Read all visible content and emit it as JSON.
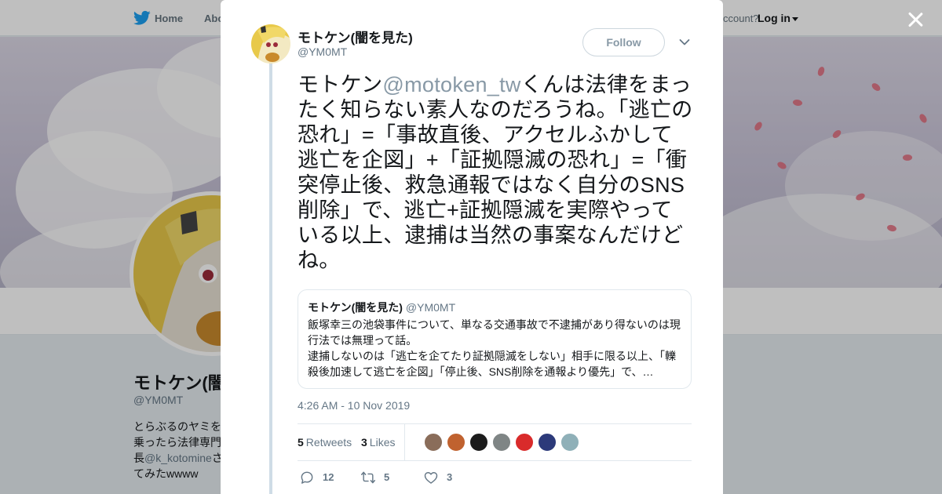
{
  "background_page": {
    "nav": {
      "home_label": "Home",
      "about_label": "Abo",
      "account_question": "ccount?",
      "login_label": "Log in"
    },
    "profile": {
      "name": "モトケン(闇",
      "handle": "@YM0MT",
      "bio_lines": [
        "とらぶるのヤミを",
        "乗ったら法律専門"
      ],
      "bio_line3_prefix": "長",
      "bio_mention": "@k_kotomine",
      "bio_line3_suffix": "さ",
      "bio_line4": "てみたwwww"
    }
  },
  "modal": {
    "close_label": "Close",
    "author": {
      "name": "モトケン(闇を見た)",
      "handle": "@YM0MT"
    },
    "follow_label": "Follow",
    "tweet": {
      "text_prefix": "モトケン",
      "mention": "@motoken_tw",
      "text_body": "くんは法律をまったく知らない素人なのだろうね。「逃亡の恐れ」=「事故直後、アクセルふかして逃亡を企図」+「証拠隠滅の恐れ」=「衝突停止後、救急通報ではなく自分のSNS削除」で、逃亡+証拠隠滅を実際やっている以上、逮捕は当然の事案なんだけどね。"
    },
    "quoted_tweet": {
      "name": "モトケン(闇を見た)",
      "handle": "@YM0MT",
      "text": "飯塚幸三の池袋事件について、単なる交通事故で不逮捕があり得ないのは現行法では無理って話。\n逮捕しないのは「逃亡を企てたり証拠隠滅をしない」相手に限る以上、「轢殺後加速して逃亡を企図」「停止後、SNS削除を通報より優先」で、…"
    },
    "timestamp": "4:26 AM - 10 Nov 2019",
    "stats": {
      "retweets_count": "5",
      "retweets_label": "Retweets",
      "likes_count": "3",
      "likes_label": "Likes"
    },
    "liker_avatar_colors": [
      "#8a6d5a",
      "#c0622f",
      "#1c1c1c",
      "#7f8585",
      "#d92b2b",
      "#2c3a7a",
      "#8fb0b8"
    ],
    "actions": {
      "replies": "12",
      "retweets": "5",
      "likes": "3"
    }
  },
  "colors": {
    "text_primary": "#14171a",
    "text_secondary": "#657786",
    "mention": "#8899a6",
    "brand_blue": "#1da1f2",
    "border": "#e1e8ed"
  }
}
